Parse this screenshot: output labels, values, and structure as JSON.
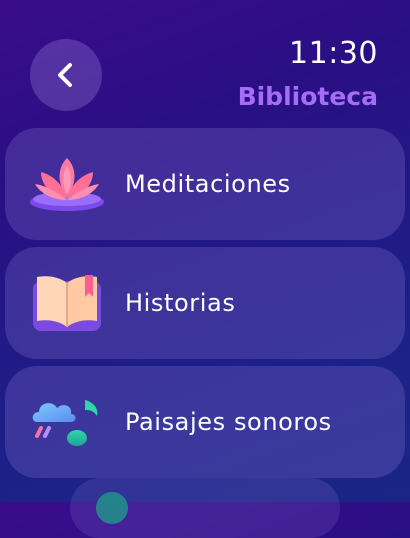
{
  "header": {
    "back_icon": "chevron-left-icon",
    "time": "11:30",
    "title": "Biblioteca",
    "title_color": "#a56cf5"
  },
  "library": {
    "items": [
      {
        "label": "Meditaciones",
        "icon": "lotus-icon"
      },
      {
        "label": "Historias",
        "icon": "open-book-icon"
      },
      {
        "label": "Paisajes sonoros",
        "icon": "cloud-music-note-icon"
      }
    ]
  }
}
